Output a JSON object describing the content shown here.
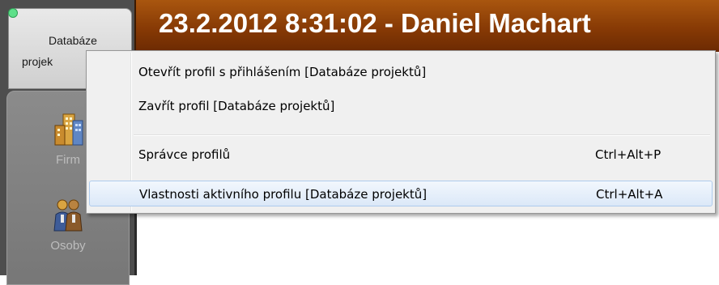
{
  "sidebar": {
    "profile_tab": {
      "line1": "Databáze",
      "line2": "projek"
    },
    "nav_items": [
      {
        "label": "Firm",
        "icon": "buildings-icon"
      },
      {
        "label": "Osoby",
        "icon": "people-icon"
      }
    ]
  },
  "titlebar": {
    "text": "23.2.2012 8:31:02 - Daniel Machart"
  },
  "context_menu": {
    "items": [
      {
        "label": "Otevřít profil s přihlášením [Databáze projektů]",
        "shortcut": ""
      },
      {
        "label": "Zavřít profil [Databáze projektů]",
        "shortcut": ""
      },
      {
        "label": "Správce profilů",
        "shortcut": "Ctrl+Alt+P"
      },
      {
        "label": "Vlastnosti aktivního profilu [Databáze projektů]",
        "shortcut": "Ctrl+Alt+A"
      }
    ]
  },
  "colors": {
    "titlebar": "#873a05",
    "sidebar": "#4e4e4e",
    "menu_hover": "#dbe8f8",
    "status_dot": "#5ee08a"
  }
}
